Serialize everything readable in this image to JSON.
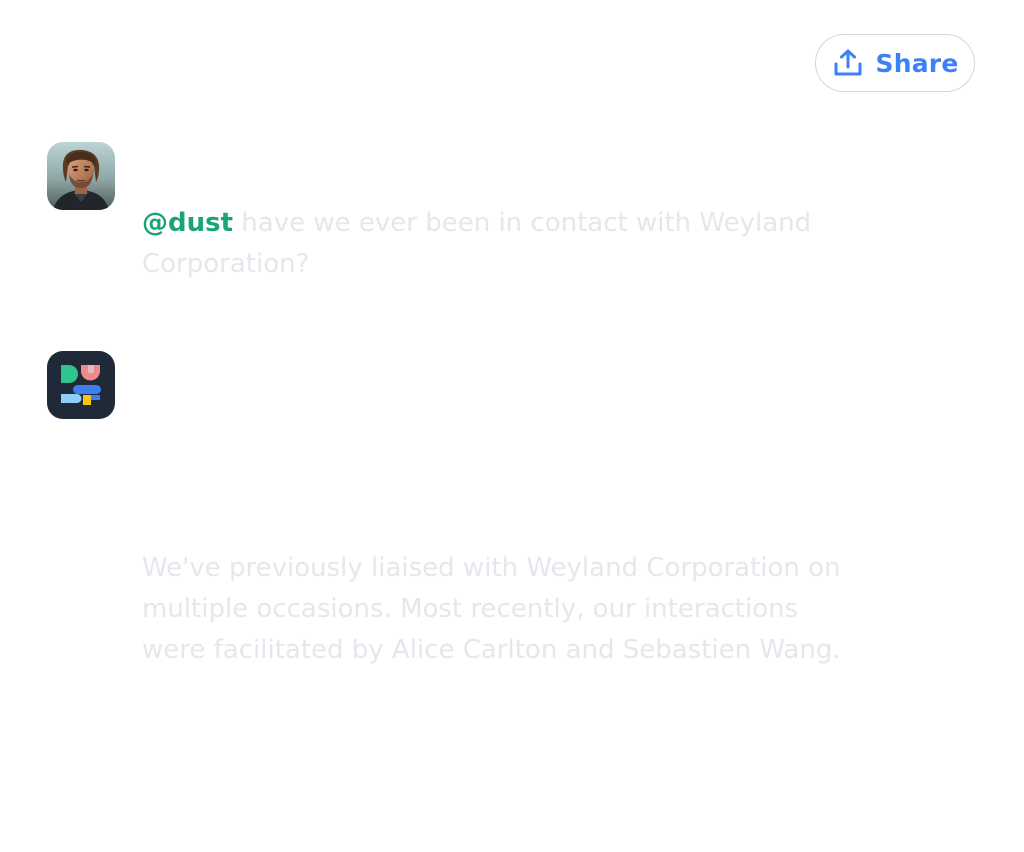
{
  "header": {
    "share_label": "Share",
    "share_icon": "share-upload-icon"
  },
  "colors": {
    "accent": "#3b82f6",
    "mention": "#1aa47a",
    "message_text": "#e5e7ec",
    "bot_avatar_bg": "#1f2937"
  },
  "conversation": {
    "user_message": {
      "mention": "@dust",
      "text": " have we ever been in contact with Weyland Corporation?"
    },
    "assistant_message": {
      "text": "We've previously liaised with Weyland Corporation on multiple occasions. Most recently, our interactions were facilitated by Alice Carlton and Sebastien Wang."
    }
  }
}
